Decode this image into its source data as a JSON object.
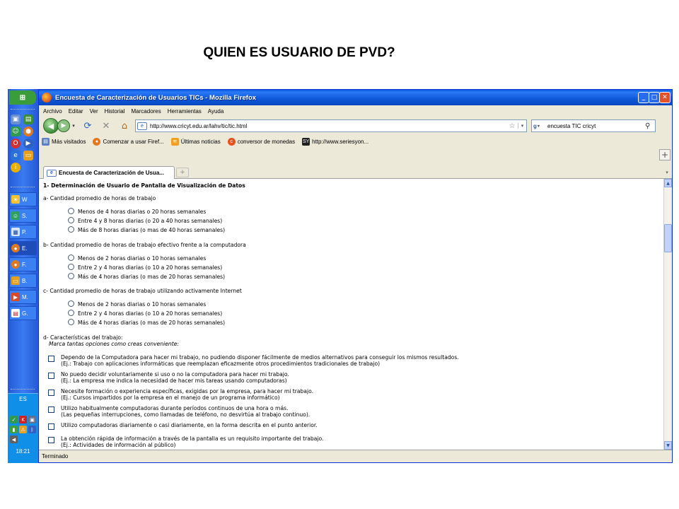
{
  "slide_title": "QUIEN ES USUARIO DE PVD?",
  "window": {
    "title": "Encuesta de Caracterización de Usuarios TICs - Mozilla Firefox"
  },
  "menu": [
    "Archivo",
    "Editar",
    "Ver",
    "Historial",
    "Marcadores",
    "Herramientas",
    "Ayuda"
  ],
  "url": "http://www.cricyt.edu.ar/lahv/tic/tic.html",
  "search": {
    "value": "encuesta TIC cricyt"
  },
  "bookmarks": [
    "Más visitados",
    "Comenzar a usar Firef...",
    "Últimas noticias",
    "conversor de monedas",
    "http://www.seriesyon..."
  ],
  "tab": {
    "title": "Encuesta de Caracterización de Usua..."
  },
  "status": "Terminado",
  "taskbar": {
    "start_label": "",
    "tasks": [
      {
        "label": "W",
        "icon": "weather-icon"
      },
      {
        "label": "S.",
        "icon": "messenger-icon"
      },
      {
        "label": "P.",
        "icon": "presentation-icon"
      },
      {
        "label": "E.",
        "icon": "firefox-icon",
        "active": true
      },
      {
        "label": "F.",
        "icon": "firefox-icon"
      },
      {
        "label": "B.",
        "icon": "folder-icon"
      },
      {
        "label": "M.",
        "icon": "media-icon"
      },
      {
        "label": "G.",
        "icon": "pdf-icon"
      }
    ],
    "language": "ES",
    "clock": "18:21"
  },
  "form": {
    "section_title": "1- Determinación de Usuario de Pantalla de Visualización de Datos",
    "q_a": {
      "label": "a- Cantidad promedio de horas de trabajo",
      "options": [
        "Menos de 4 horas diarias o 20 horas semanales",
        "Entre 4 y 8 horas diarias (o 20 a 40 horas semanales)",
        "Más de 8 horas diarias (o mas de 40 horas semanales)"
      ]
    },
    "q_b": {
      "label": "b- Cantidad promedio de horas de trabajo efectivo frente a la computadora",
      "options": [
        "Menos de 2 horas diarias o 10 horas semanales",
        "Entre 2 y 4 horas diarias (o 10 a 20 horas semanales)",
        "Más de 4 horas diarias (o mas de 20 horas semanales)"
      ]
    },
    "q_c": {
      "label": "c- Cantidad promedio de horas de trabajo utilizando activamente Internet",
      "options": [
        "Menos de 2 horas diarias o 10 horas semanales",
        "Entre 2 y 4 horas diarias (o 10 a 20 horas semanales)",
        "Más de 4 horas diarias (o mas de 20 horas semanales)"
      ]
    },
    "q_d": {
      "label": "d- Características del trabajo:",
      "hint": "Marca tantas opciones como creas conveniente:",
      "items": [
        {
          "line1": "Dependo de la Computadora para hacer mi trabajo, no pudiendo disponer fácilmente de medios alternativos para conseguir los mismos resultados.",
          "line2": "(Ej.: Trabajo con aplicaciones informáticas que reemplazan eficazmente otros procedimientos tradicionales de trabajo)"
        },
        {
          "line1": "No puedo decidir voluntariamente si uso o no la computadora para hacer mi trabajo.",
          "line2": "(Ej.: La empresa me indica la necesidad de hacer mis tareas usando computadoras)"
        },
        {
          "line1": "Necesite formación o experiencia específicas, exigidas por la empresa, para hacer mi trabajo.",
          "line2": "(Ej.: Cursos impartidos por la empresa en el manejo de un programa informático)"
        },
        {
          "line1": "Utilizo habitualmente computadoras durante períodos continuos de una hora o más.",
          "line2": "(Las pequeñas interrupciones, como llamadas de teléfono, no desvirtúa al trabajo continuo)."
        },
        {
          "line1": "Utilizo computadoras diariamente o casi diariamente, en la forma descrita en el punto anterior.",
          "line2": ""
        },
        {
          "line1": "La obtención rápida de información a través de la pantalla es un requisito importante del trabajo.",
          "line2": "(Ej.: Actividades de información al público)"
        }
      ]
    }
  }
}
